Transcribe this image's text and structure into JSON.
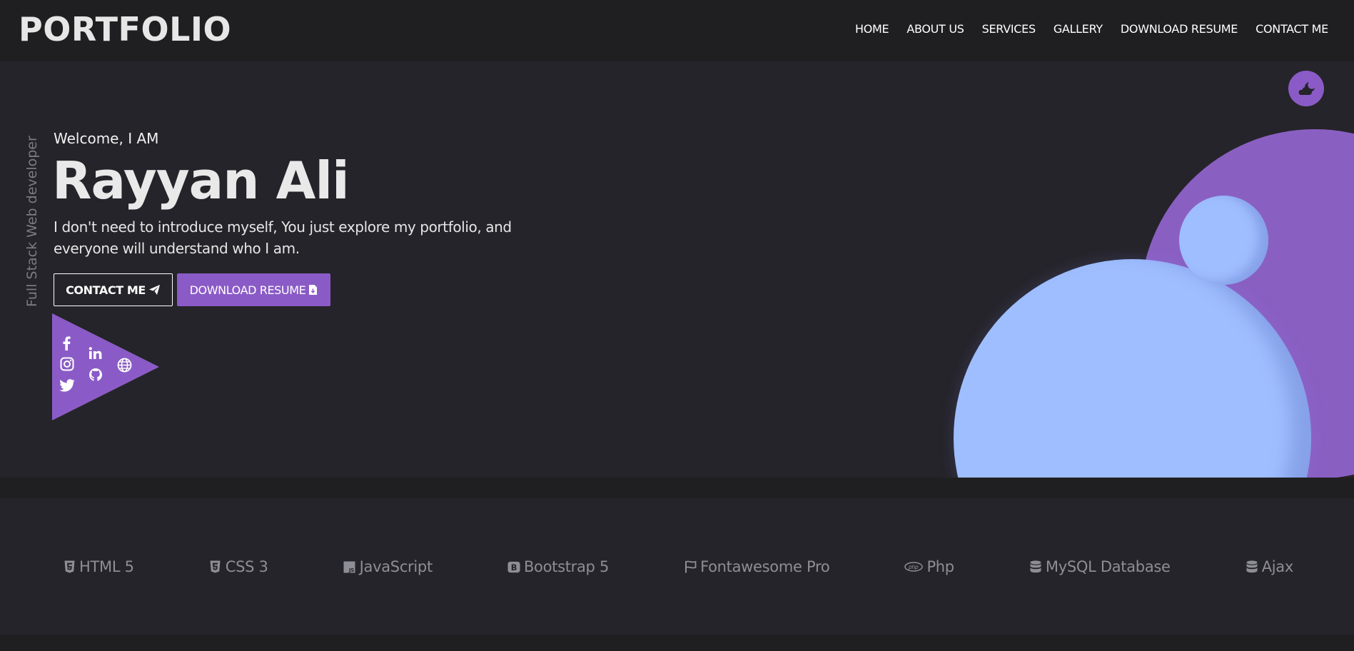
{
  "navbar": {
    "brand": "PORTFOLIO",
    "links": [
      "HOME",
      "ABOUT US",
      "SERVICES",
      "GALLERY",
      "DOWNLOAD RESUME",
      "CONTACT ME"
    ]
  },
  "hero": {
    "vertical_text": "Full Stack Web developer",
    "welcome": "Welcome, I AM",
    "name": "Rayyan Ali",
    "intro": "I don't need to introduce myself, You just explore my portfolio, and everyone will understand who I am.",
    "contact_button": "CONTACT ME",
    "resume_button": "DOWNLOAD RESUME",
    "theme_toggle_icon": "cloud-moon-icon",
    "social_icons": [
      "facebook-icon",
      "linkedin-icon",
      "instagram-icon",
      "github-icon",
      "globe-icon",
      "twitter-icon"
    ]
  },
  "skills": [
    {
      "label": "HTML 5",
      "icon": "html5-icon"
    },
    {
      "label": "CSS 3",
      "icon": "css3-icon"
    },
    {
      "label": "JavaScript",
      "icon": "js-icon"
    },
    {
      "label": "Bootstrap 5",
      "icon": "bootstrap-icon"
    },
    {
      "label": "Fontawesome Pro",
      "icon": "flag-icon"
    },
    {
      "label": "Php",
      "icon": "php-icon"
    },
    {
      "label": "MySQL Database",
      "icon": "database-icon"
    },
    {
      "label": "Ajax",
      "icon": "database-icon"
    }
  ],
  "colors": {
    "accent": "#8a5bc6",
    "circle_blue": "#9fbeff",
    "background": "#25242a",
    "navbar": "#1f1f21"
  }
}
